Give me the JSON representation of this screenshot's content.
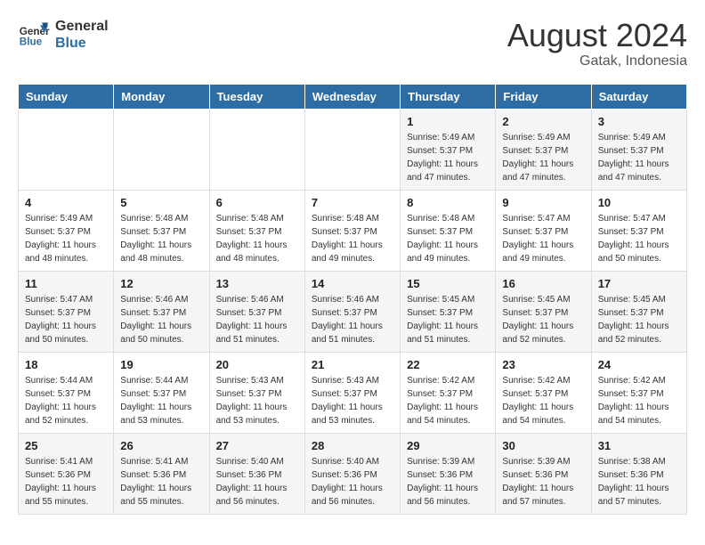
{
  "header": {
    "logo_line1": "General",
    "logo_line2": "Blue",
    "month_year": "August 2024",
    "location": "Gatak, Indonesia"
  },
  "weekdays": [
    "Sunday",
    "Monday",
    "Tuesday",
    "Wednesday",
    "Thursday",
    "Friday",
    "Saturday"
  ],
  "weeks": [
    [
      {
        "day": "",
        "info": ""
      },
      {
        "day": "",
        "info": ""
      },
      {
        "day": "",
        "info": ""
      },
      {
        "day": "",
        "info": ""
      },
      {
        "day": "1",
        "info": "Sunrise: 5:49 AM\nSunset: 5:37 PM\nDaylight: 11 hours and 47 minutes."
      },
      {
        "day": "2",
        "info": "Sunrise: 5:49 AM\nSunset: 5:37 PM\nDaylight: 11 hours and 47 minutes."
      },
      {
        "day": "3",
        "info": "Sunrise: 5:49 AM\nSunset: 5:37 PM\nDaylight: 11 hours and 47 minutes."
      }
    ],
    [
      {
        "day": "4",
        "info": "Sunrise: 5:49 AM\nSunset: 5:37 PM\nDaylight: 11 hours and 48 minutes."
      },
      {
        "day": "5",
        "info": "Sunrise: 5:48 AM\nSunset: 5:37 PM\nDaylight: 11 hours and 48 minutes."
      },
      {
        "day": "6",
        "info": "Sunrise: 5:48 AM\nSunset: 5:37 PM\nDaylight: 11 hours and 48 minutes."
      },
      {
        "day": "7",
        "info": "Sunrise: 5:48 AM\nSunset: 5:37 PM\nDaylight: 11 hours and 49 minutes."
      },
      {
        "day": "8",
        "info": "Sunrise: 5:48 AM\nSunset: 5:37 PM\nDaylight: 11 hours and 49 minutes."
      },
      {
        "day": "9",
        "info": "Sunrise: 5:47 AM\nSunset: 5:37 PM\nDaylight: 11 hours and 49 minutes."
      },
      {
        "day": "10",
        "info": "Sunrise: 5:47 AM\nSunset: 5:37 PM\nDaylight: 11 hours and 50 minutes."
      }
    ],
    [
      {
        "day": "11",
        "info": "Sunrise: 5:47 AM\nSunset: 5:37 PM\nDaylight: 11 hours and 50 minutes."
      },
      {
        "day": "12",
        "info": "Sunrise: 5:46 AM\nSunset: 5:37 PM\nDaylight: 11 hours and 50 minutes."
      },
      {
        "day": "13",
        "info": "Sunrise: 5:46 AM\nSunset: 5:37 PM\nDaylight: 11 hours and 51 minutes."
      },
      {
        "day": "14",
        "info": "Sunrise: 5:46 AM\nSunset: 5:37 PM\nDaylight: 11 hours and 51 minutes."
      },
      {
        "day": "15",
        "info": "Sunrise: 5:45 AM\nSunset: 5:37 PM\nDaylight: 11 hours and 51 minutes."
      },
      {
        "day": "16",
        "info": "Sunrise: 5:45 AM\nSunset: 5:37 PM\nDaylight: 11 hours and 52 minutes."
      },
      {
        "day": "17",
        "info": "Sunrise: 5:45 AM\nSunset: 5:37 PM\nDaylight: 11 hours and 52 minutes."
      }
    ],
    [
      {
        "day": "18",
        "info": "Sunrise: 5:44 AM\nSunset: 5:37 PM\nDaylight: 11 hours and 52 minutes."
      },
      {
        "day": "19",
        "info": "Sunrise: 5:44 AM\nSunset: 5:37 PM\nDaylight: 11 hours and 53 minutes."
      },
      {
        "day": "20",
        "info": "Sunrise: 5:43 AM\nSunset: 5:37 PM\nDaylight: 11 hours and 53 minutes."
      },
      {
        "day": "21",
        "info": "Sunrise: 5:43 AM\nSunset: 5:37 PM\nDaylight: 11 hours and 53 minutes."
      },
      {
        "day": "22",
        "info": "Sunrise: 5:42 AM\nSunset: 5:37 PM\nDaylight: 11 hours and 54 minutes."
      },
      {
        "day": "23",
        "info": "Sunrise: 5:42 AM\nSunset: 5:37 PM\nDaylight: 11 hours and 54 minutes."
      },
      {
        "day": "24",
        "info": "Sunrise: 5:42 AM\nSunset: 5:37 PM\nDaylight: 11 hours and 54 minutes."
      }
    ],
    [
      {
        "day": "25",
        "info": "Sunrise: 5:41 AM\nSunset: 5:36 PM\nDaylight: 11 hours and 55 minutes."
      },
      {
        "day": "26",
        "info": "Sunrise: 5:41 AM\nSunset: 5:36 PM\nDaylight: 11 hours and 55 minutes."
      },
      {
        "day": "27",
        "info": "Sunrise: 5:40 AM\nSunset: 5:36 PM\nDaylight: 11 hours and 56 minutes."
      },
      {
        "day": "28",
        "info": "Sunrise: 5:40 AM\nSunset: 5:36 PM\nDaylight: 11 hours and 56 minutes."
      },
      {
        "day": "29",
        "info": "Sunrise: 5:39 AM\nSunset: 5:36 PM\nDaylight: 11 hours and 56 minutes."
      },
      {
        "day": "30",
        "info": "Sunrise: 5:39 AM\nSunset: 5:36 PM\nDaylight: 11 hours and 57 minutes."
      },
      {
        "day": "31",
        "info": "Sunrise: 5:38 AM\nSunset: 5:36 PM\nDaylight: 11 hours and 57 minutes."
      }
    ]
  ]
}
